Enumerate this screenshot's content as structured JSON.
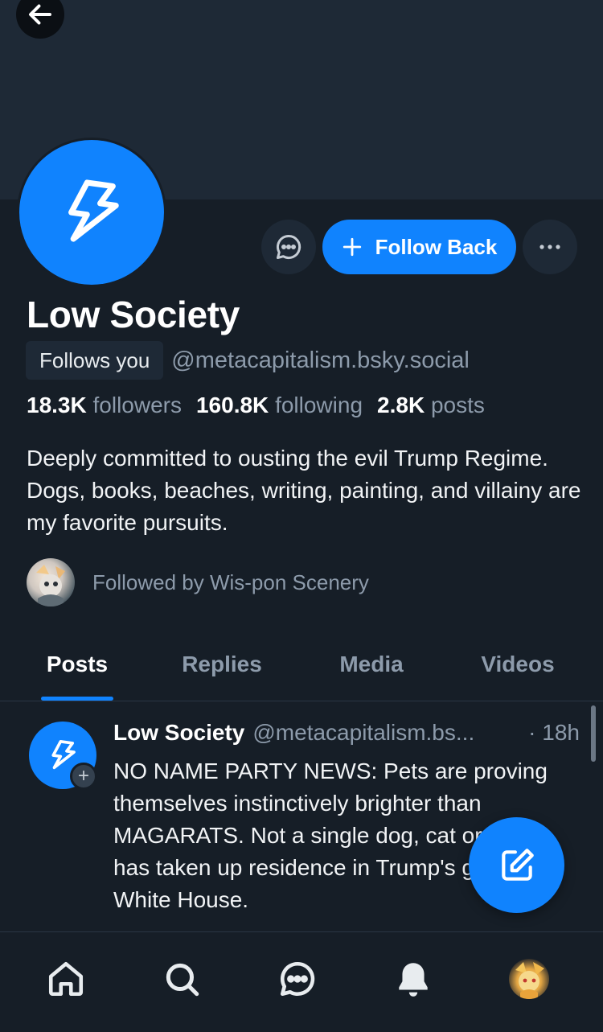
{
  "profile": {
    "display_name": "Low Society",
    "follows_you_label": "Follows you",
    "handle": "@metacapitalism.bsky.social",
    "followers_count": "18.3K",
    "followers_label": "followers",
    "following_count": "160.8K",
    "following_label": "following",
    "posts_count": "2.8K",
    "posts_label": "posts",
    "bio": "Deeply committed to ousting the evil Trump Regime. Dogs, books, beaches, writing, painting, and villainy are my favorite pursuits.",
    "followed_by": "Followed by Wis-pon Scenery"
  },
  "actions": {
    "follow_label": "Follow Back"
  },
  "tabs": [
    {
      "label": "Posts",
      "active": true
    },
    {
      "label": "Replies",
      "active": false
    },
    {
      "label": "Media",
      "active": false
    },
    {
      "label": "Videos",
      "active": false
    }
  ],
  "post": {
    "author": "Low Society",
    "handle": "@metacapitalism.bs...",
    "time": "· 18h",
    "text": "NO NAME PARTY NEWS: Pets are proving themselves instinctively brighter than MAGARATS. Not a single dog, cat or bunny has taken up residence in Trump's golden White House."
  },
  "nav": {
    "items": [
      "home-icon",
      "search-icon",
      "chat-icon",
      "bell-icon",
      "profile-avatar"
    ]
  },
  "colors": {
    "accent": "#1083fe",
    "background": "#161e27",
    "muted_text": "#8d9bab"
  }
}
